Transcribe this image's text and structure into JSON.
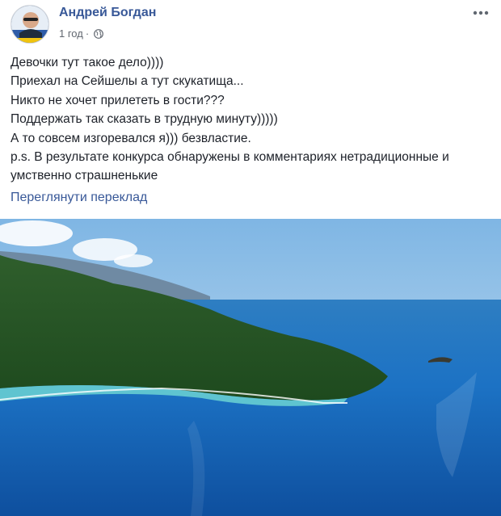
{
  "post": {
    "author": "Андрей Богдан",
    "time": "1 год",
    "separator": "·",
    "privacy_icon": "globe-icon",
    "more_icon": "more-options-icon",
    "lines": [
      "Девочки тут такое дело))))",
      "Приехал на Сейшелы а тут скукатища...",
      "Никто не хочет прилететь в гости???",
      "Поддержать так сказать в трудную минуту)))))",
      "А то совсем изгоревался я))) безвластие.",
      "p.s. В результате конкурса обнаружены в комментариях нетрадиционные и умственно страшненькие"
    ],
    "translate_link": "Переглянути переклад"
  },
  "colors": {
    "link": "#385898",
    "text": "#1d2129",
    "meta": "#616770"
  }
}
